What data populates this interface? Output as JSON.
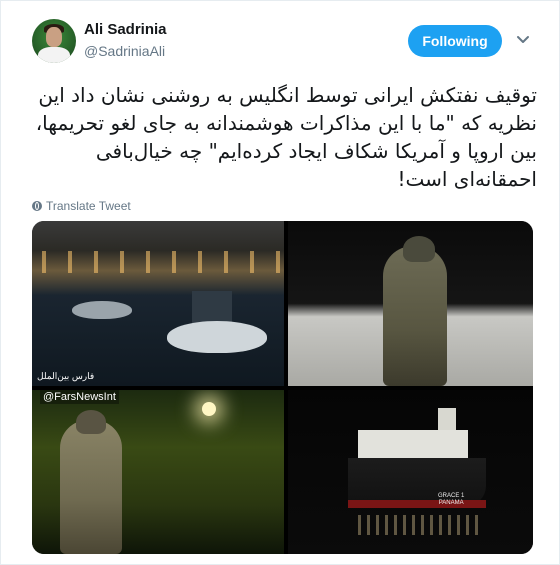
{
  "author": {
    "name": "Ali Sadrinia",
    "handle": "@SadriniaAli"
  },
  "actions": {
    "follow_label": "Following"
  },
  "tweet": {
    "text": "توقیف نفتکش ایرانی توسط انگلیس به روشنی نشان داد این نظریه که \"ما با این مذاکرات هوشمندانه به جای لغو تحریمها، بین اروپا و آمریکا شکاف ایجاد کرده‌ایم\" چه خیال‌بافی احمقانه‌ای است!",
    "translate_label": "Translate Tweet"
  },
  "media": {
    "watermark_agency": "فارس بین‌الملل",
    "watermark_handle": "@FarsNewsInt",
    "ship_name": "GRACE 1",
    "ship_port": "PANAMA"
  },
  "icons": [
    "avatar",
    "chevron-down-icon",
    "globe-icon"
  ],
  "colors": {
    "accent": "#1da1f2",
    "secondary_text": "#657786",
    "border": "#e6ecf0"
  }
}
